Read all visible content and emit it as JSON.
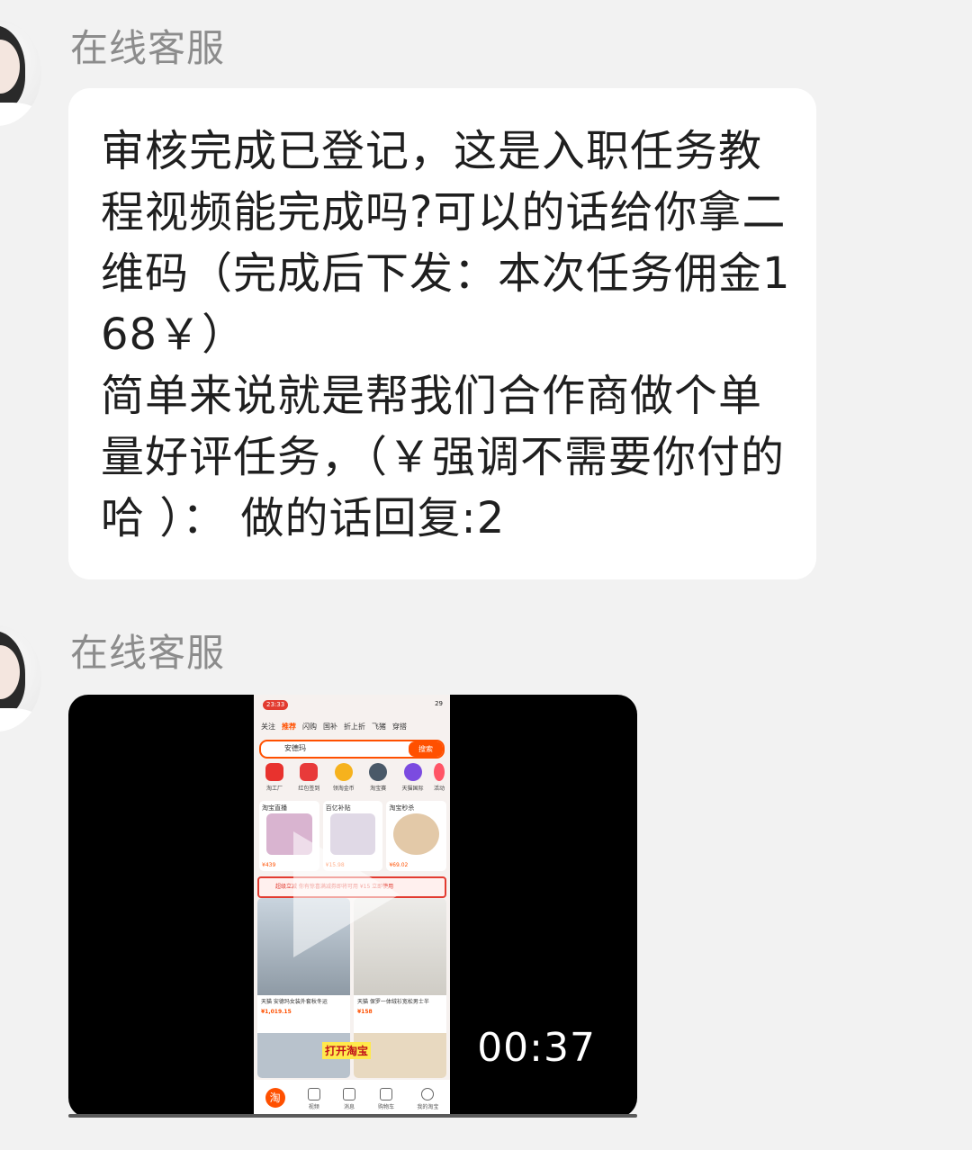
{
  "messages": [
    {
      "sender": "在线客服",
      "avatar_icon": "avatar-woman",
      "text": "审核完成已登记，这是入职任务教程视频能完成吗?可以的话给你拿二维码（完成后下发：本次任务佣金168￥）\n简单来说就是帮我们合作商做个单量好评任务，（￥强调不需要你付的哈 ）： 做的话回复:2"
    },
    {
      "sender": "在线客服",
      "avatar_icon": "avatar-woman",
      "video": {
        "duration": "00:37",
        "play_icon": "play-icon",
        "phone_screen": {
          "time": "23:33",
          "battery": "29",
          "tabs": [
            "关注",
            "推荐",
            "闪购",
            "国补",
            "折上折",
            "飞猪",
            "穿搭"
          ],
          "active_tab": "推荐",
          "search_text": "安德玛",
          "search_button": "搜索",
          "icons": [
            "淘工厂",
            "红包签到",
            "领淘金币",
            "淘宝赛",
            "天猫国际",
            "活动"
          ],
          "cards": [
            "淘宝直播",
            "百亿补贴",
            "淘宝秒杀"
          ],
          "card_prices": [
            "¥439",
            "¥15.98",
            "¥69.02"
          ],
          "banner": "超级立减  你有惊喜满减券即将可用   ¥15  立即使用",
          "feed": [
            {
              "title": "天猫 安德玛女装外套秋冬运",
              "price": "¥1,019.15"
            },
            {
              "title": "天猫 保罗一体绒衫宽松男士半",
              "price": "¥158"
            }
          ],
          "subtitle": "打开淘宝",
          "tabbar": [
            "淘",
            "视频",
            "消息",
            "购物车",
            "我的淘宝"
          ]
        }
      }
    }
  ]
}
